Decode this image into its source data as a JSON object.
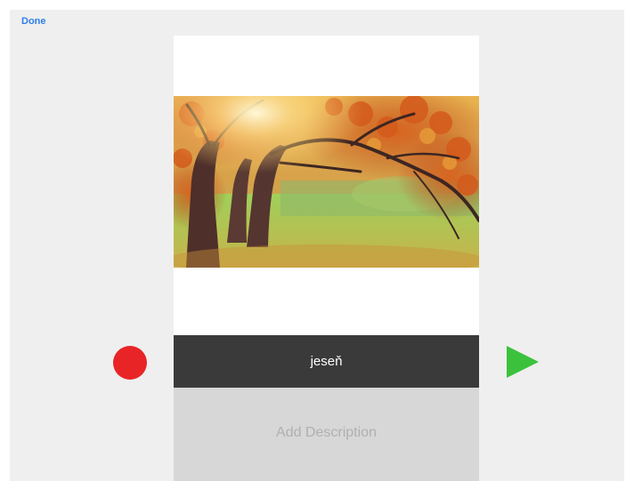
{
  "toolbar": {
    "done_label": "Done"
  },
  "card": {
    "title": "jeseň",
    "description_placeholder": "Add Description",
    "image_icon": "autumn-tree-photo"
  },
  "controls": {
    "record_icon": "record-circle-icon",
    "play_icon": "play-triangle-icon"
  },
  "colors": {
    "accent": "#2f7fe8",
    "background": "#efefef",
    "title_bar": "#3a3a3a",
    "description_bg": "#d7d7d7",
    "record": "#e82427",
    "play": "#3cc13c"
  }
}
